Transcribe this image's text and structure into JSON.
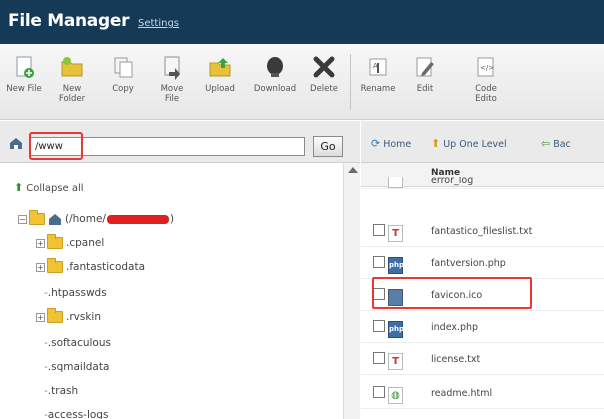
{
  "header": {
    "title": "File Manager",
    "settings_link": "Settings"
  },
  "toolbar": {
    "buttons": [
      {
        "label_line1": "New File",
        "label_line2": "",
        "icon": "new-file-icon"
      },
      {
        "label_line1": "New",
        "label_line2": "Folder",
        "icon": "new-folder-icon"
      },
      {
        "label_line1": "Copy",
        "label_line2": "",
        "icon": "copy-icon"
      },
      {
        "label_line1": "Move",
        "label_line2": "File",
        "icon": "move-file-icon"
      },
      {
        "label_line1": "Upload",
        "label_line2": "",
        "icon": "upload-icon"
      },
      {
        "label_line1": "Download",
        "label_line2": "",
        "icon": "download-icon"
      },
      {
        "label_line1": "Delete",
        "label_line2": "",
        "icon": "delete-icon"
      },
      {
        "label_line1": "Rename",
        "label_line2": "",
        "icon": "rename-icon"
      },
      {
        "label_line1": "Edit",
        "label_line2": "",
        "icon": "edit-icon"
      },
      {
        "label_line1": "Code",
        "label_line2": "Edito",
        "icon": "code-editor-icon"
      }
    ]
  },
  "path_bar": {
    "value": "/www",
    "go_label": "Go"
  },
  "tree": {
    "collapse_label": "Collapse all",
    "root_prefix": "(/home/",
    "root_suffix": ")",
    "items": [
      {
        "label": ".cpanel"
      },
      {
        "label": ".fantasticodata"
      },
      {
        "label": ".htpasswds"
      },
      {
        "label": ".rvskin"
      },
      {
        "label": ".softaculous"
      },
      {
        "label": ".sqmaildata"
      },
      {
        "label": ".trash"
      },
      {
        "label": "access-logs"
      }
    ]
  },
  "nav": {
    "home": "Home",
    "up_one_level": "Up One Level",
    "back": "Bac"
  },
  "file_list": {
    "column_name": "Name",
    "files": [
      {
        "name": "error_log",
        "type": "txt"
      },
      {
        "name": "fantastico_fileslist.txt",
        "type": "txt"
      },
      {
        "name": "fantversion.php",
        "type": "php"
      },
      {
        "name": "favicon.ico",
        "type": "ico"
      },
      {
        "name": "index.php",
        "type": "php"
      },
      {
        "name": "license.txt",
        "type": "txt"
      },
      {
        "name": "readme.html",
        "type": "html"
      }
    ]
  },
  "colors": {
    "header_bg": "#143a57",
    "highlight": "#e53935"
  }
}
